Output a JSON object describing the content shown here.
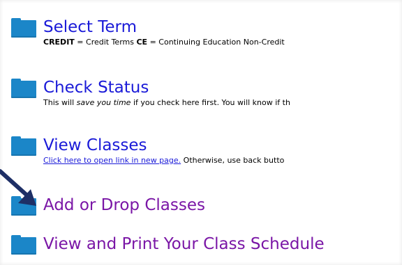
{
  "items": [
    {
      "title": "Select Term",
      "desc_credit_label": "CREDIT",
      "desc_credit_text": " = Credit Terms ",
      "desc_ce_label": "CE",
      "desc_ce_text": " = Continuing Education Non-Credit"
    },
    {
      "title": "Check Status",
      "desc_a": "This will ",
      "desc_em": "save you time",
      "desc_b": " if you check here first. You will know if th"
    },
    {
      "title": "View Classes",
      "desc_link": "Click here to open link in new page.",
      "desc_rest": " Otherwise, use back butto"
    },
    {
      "title": "Add or Drop Classes"
    },
    {
      "title": "View and Print Your Class Schedule"
    }
  ],
  "colors": {
    "folder": "#1b86c8",
    "link": "#1a1ad8",
    "visited_link": "#7a16a6",
    "arrow": "#1e2f66"
  }
}
